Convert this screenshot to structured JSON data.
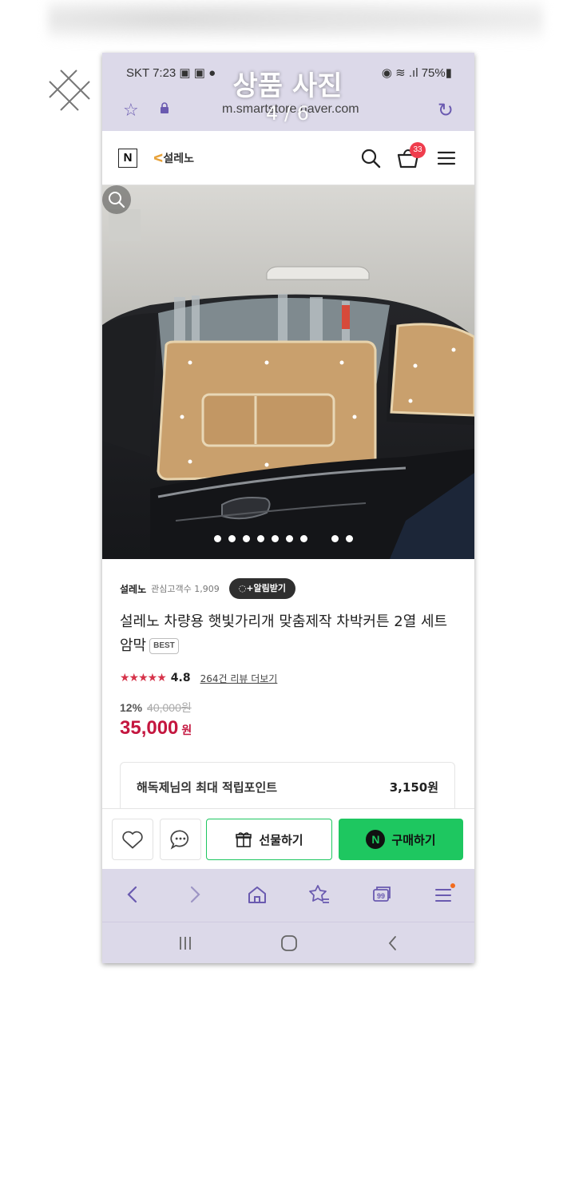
{
  "viewer": {
    "title": "상품 사진",
    "counter": "4 / 6"
  },
  "status_bar": {
    "left": "SKT 7:23 ▣ ▣ ●",
    "right": "◉ ≋ .ıl 75%▮"
  },
  "url_bar": {
    "url": "m.smartstore.naver.com"
  },
  "store_header": {
    "n_logo": "N",
    "store_name_mark": "ᐸ",
    "store_name": "설레노",
    "cart_count": "33"
  },
  "product": {
    "seller": "설레노",
    "follower_text": "관심고객수 1,909",
    "alarm_button": "◌+알림받기",
    "title": "설레노 차량용 햇빛가리개 맞춤제작 차박커튼 2열 세트 암막",
    "badge": "BEST",
    "stars": "★★★★★",
    "rating": "4.8",
    "reviews_link": "264건 리뷰 더보기",
    "discount": "12%",
    "original_price": "40,000원",
    "price": "35,000",
    "price_unit": "원",
    "points_label": "해독제님의 최대 적립포인트",
    "points_value": "3,150원"
  },
  "actions": {
    "gift": "선물하기",
    "buy_icon": "N",
    "buy": "구매하기"
  },
  "photo": {
    "dots_count": 9
  },
  "colors": {
    "browser_chrome": "#dcd9e9",
    "accent_purple": "#6a5ab0",
    "naver_green": "#1ec760",
    "price_red": "#c4163f",
    "badge_red": "#ef3d4d"
  }
}
